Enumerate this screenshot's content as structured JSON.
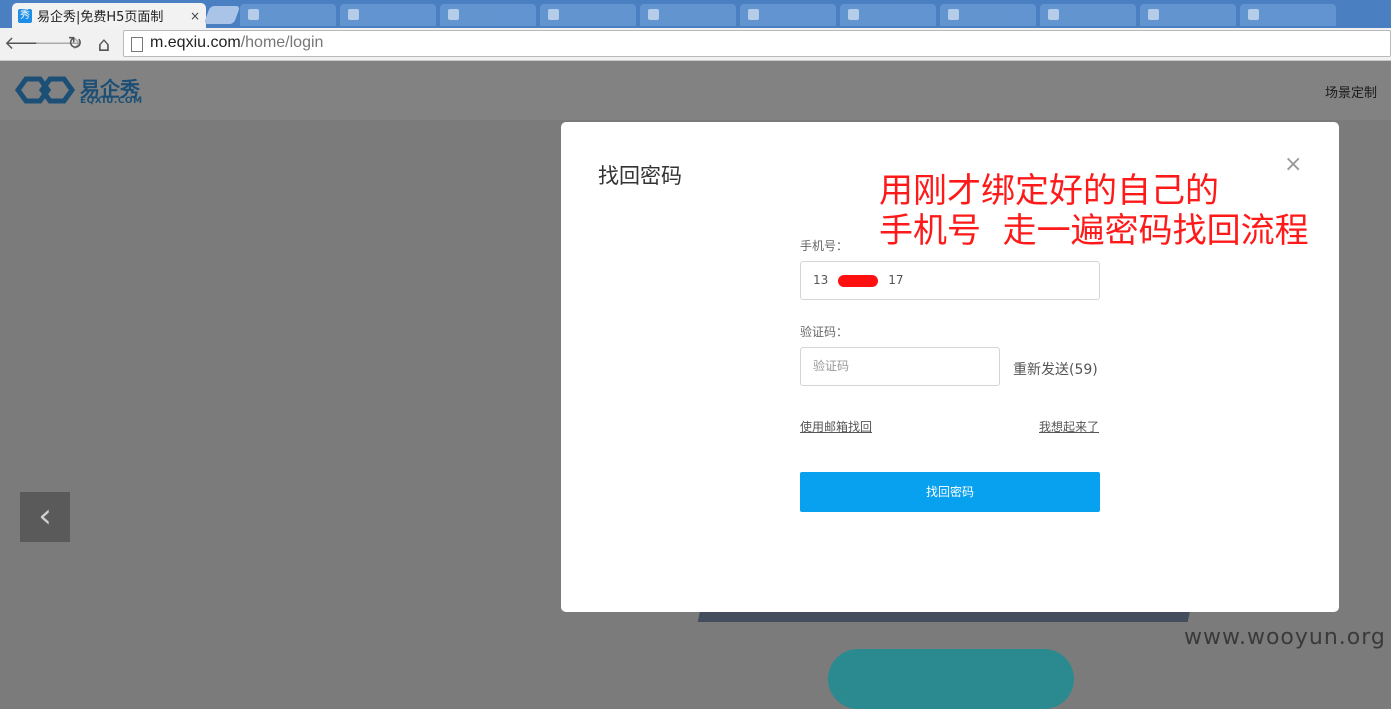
{
  "browser": {
    "active_tab_title": "易企秀|免费H5页面制",
    "active_tab_favicon": "秀",
    "tab_close": "×",
    "url_host": "m.eqxiu.com",
    "url_path": "/home/login"
  },
  "nav_icons": {
    "back": "🡐",
    "forward": "🡒",
    "reload": "↻",
    "home": "⌂"
  },
  "header": {
    "logo_cn": "易企秀",
    "logo_en": "EQXIU.COM",
    "nav_link": "场景定制"
  },
  "modal": {
    "title": "找回密码",
    "close_glyph": "×",
    "phone_label": "手机号：",
    "phone_value": "13",
    "phone_value_suffix": "17",
    "code_label": "验证码：",
    "code_placeholder": "验证码",
    "resend_label": "重新发送(59)",
    "email_link": "使用邮箱找回",
    "remember_link": "我想起来了",
    "submit_label": "找回密码"
  },
  "annotation": {
    "line1": "用刚才绑定好的自己的",
    "line2": "手机号  走一遍密码找回流程"
  },
  "carousel": {
    "prev_glyph": "‹"
  },
  "watermark": "www.wooyun.org",
  "colors": {
    "accent": "#08a1ef",
    "annotation": "#ff1a1a",
    "overlay": "#7b7b7b"
  }
}
